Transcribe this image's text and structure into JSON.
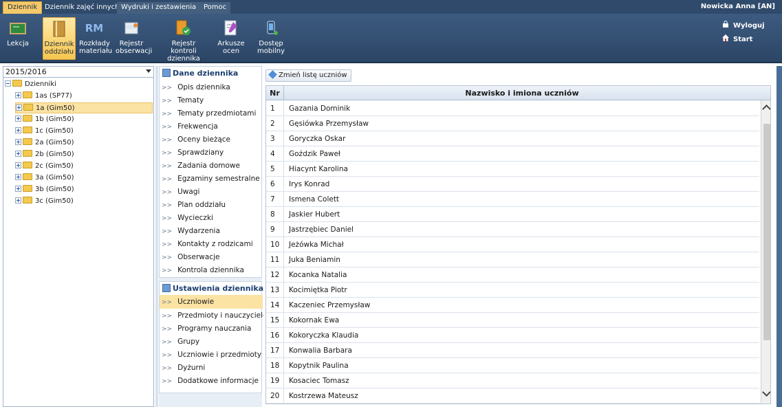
{
  "menu": {
    "tabs": [
      "Dziennik",
      "Dziennik zajęć innych",
      "Wydruki i zestawienia",
      "Pomoc"
    ],
    "user": "Nowicka Anna [AN]"
  },
  "ribbon": {
    "buttons": [
      "Lekcja",
      "Dziennik\noddziału",
      "Rozkłady\nmateriału",
      "Rejestr\nobserwacji",
      "Rejestr kontroli\ndziennika",
      "Arkusze\nocen",
      "Dostęp\nmobilny"
    ],
    "rm_badge": "RM",
    "logout": "Wyloguj",
    "start": "Start"
  },
  "tree": {
    "year": "2015/2016",
    "root": "Dzienniki",
    "items": [
      "1as (SP77)",
      "1a (Gim50)",
      "1b (Gim50)",
      "1c (Gim50)",
      "2a (Gim50)",
      "2b (Gim50)",
      "2c (Gim50)",
      "3a (Gim50)",
      "3b (Gim50)",
      "3c (Gim50)"
    ],
    "selected": "1a (Gim50)"
  },
  "nav": {
    "section1_title": "Dane dziennika",
    "section1_items": [
      "Opis dziennika",
      "Tematy",
      "Tematy przedmiotami",
      "Frekwencja",
      "Oceny bieżące",
      "Sprawdziany",
      "Zadania domowe",
      "Egzaminy semestralne",
      "Uwagi",
      "Plan oddziału",
      "Wycieczki",
      "Wydarzenia",
      "Kontakty z rodzicami",
      "Obserwacje",
      "Kontrola dziennika"
    ],
    "section2_title": "Ustawienia dziennika",
    "section2_items": [
      "Uczniowie",
      "Przedmioty i nauczyciele",
      "Programy nauczania",
      "Grupy",
      "Uczniowie i przedmioty",
      "Dyżurni",
      "Dodatkowe informacje"
    ],
    "active": "Uczniowie"
  },
  "content": {
    "change_button": "Zmień listę uczniów",
    "col_nr": "Nr",
    "col_name": "Nazwisko i imiona uczniów",
    "rows": [
      [
        "1",
        "Gazania Dominik"
      ],
      [
        "2",
        "Gęsiówka Przemysław"
      ],
      [
        "3",
        "Goryczka Oskar"
      ],
      [
        "4",
        "Goździk Paweł"
      ],
      [
        "5",
        "Hiacynt Karolina"
      ],
      [
        "6",
        "Irys Konrad"
      ],
      [
        "7",
        "Ismena Colett"
      ],
      [
        "8",
        "Jaskier Hubert"
      ],
      [
        "9",
        "Jastrzębiec Daniel"
      ],
      [
        "10",
        "Jeżówka Michał"
      ],
      [
        "11",
        "Juka Beniamin"
      ],
      [
        "12",
        "Kocanka Natalia"
      ],
      [
        "13",
        "Kocimiętka Piotr"
      ],
      [
        "14",
        "Kaczeniec Przemysław"
      ],
      [
        "15",
        "Kokornak Ewa"
      ],
      [
        "16",
        "Kokoryczka Klaudia"
      ],
      [
        "17",
        "Konwalia Barbara"
      ],
      [
        "18",
        "Kopytnik Paulina"
      ],
      [
        "19",
        "Kosaciec Tomasz"
      ],
      [
        "20",
        "Kostrzewa Mateusz"
      ]
    ]
  }
}
